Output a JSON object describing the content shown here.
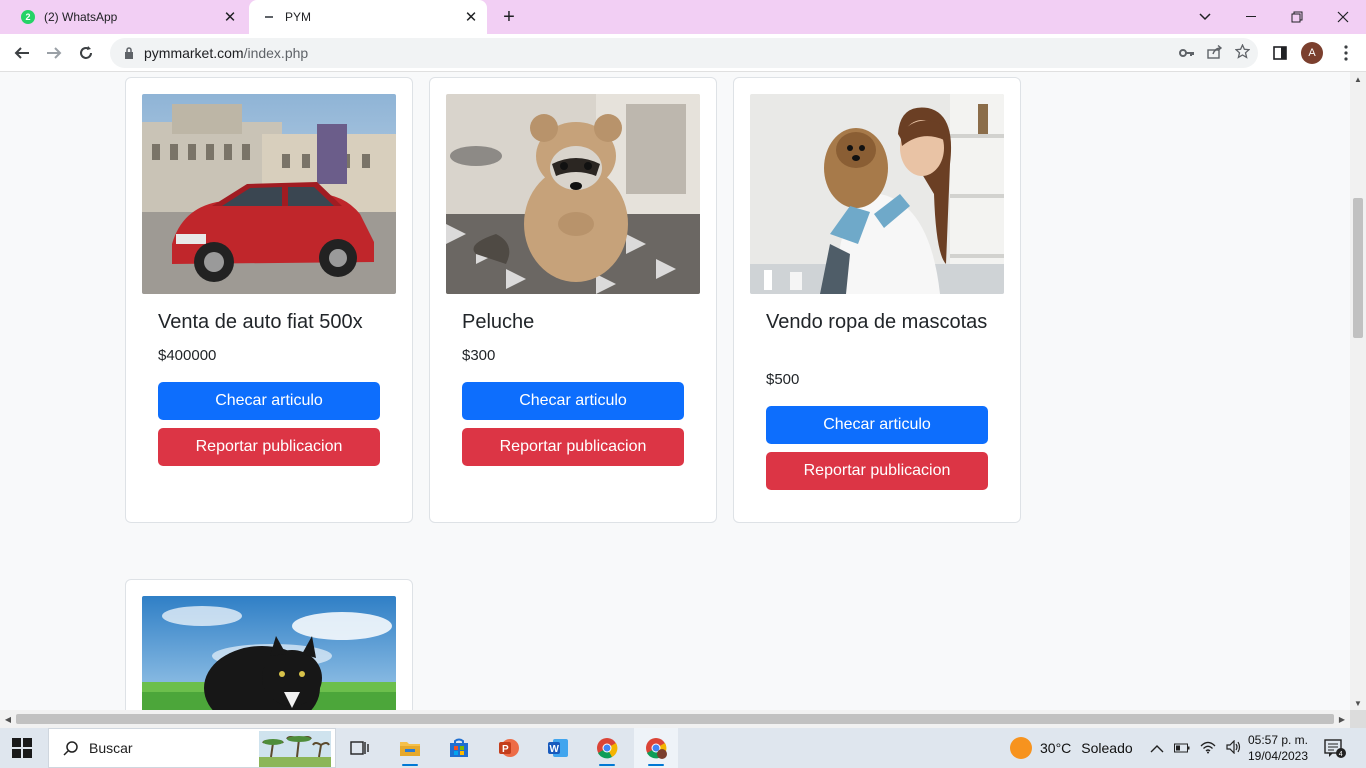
{
  "browser": {
    "tabs": [
      {
        "title": "(2) WhatsApp",
        "favicon": "whatsapp-icon",
        "badge": "2",
        "active": false
      },
      {
        "title": "PYM",
        "favicon": "loading-icon",
        "active": true
      }
    ],
    "url": {
      "host": "pymmarket.com",
      "path": "/index.php"
    },
    "profile_initial": "A"
  },
  "products": [
    {
      "title": "Venta de auto fiat 500x",
      "price": "$400000",
      "image": "red-car-photo",
      "view_label": "Checar articulo",
      "report_label": "Reportar publicacion"
    },
    {
      "title": "Peluche",
      "price": "$300",
      "image": "raccoon-photo",
      "view_label": "Checar articulo",
      "report_label": "Reportar publicacion"
    },
    {
      "title": "Vendo ropa de mascotas",
      "price": "$500",
      "image": "vet-dog-photo",
      "view_label": "Checar articulo",
      "report_label": "Reportar publicacion"
    },
    {
      "title": "",
      "price": "",
      "image": "black-cat-photo"
    }
  ],
  "colors": {
    "primary": "#0d6efd",
    "danger": "#dc3545",
    "tabstrip": "#f2cff4"
  },
  "taskbar": {
    "search_label": "Buscar",
    "weather": {
      "temp": "30°C",
      "condition": "Soleado"
    },
    "time": "05:57 p. m.",
    "date": "19/04/2023",
    "notifications": "4",
    "apps": [
      "task-view",
      "file-explorer",
      "microsoft-store",
      "powerpoint",
      "word",
      "chrome",
      "chrome-profile"
    ]
  }
}
